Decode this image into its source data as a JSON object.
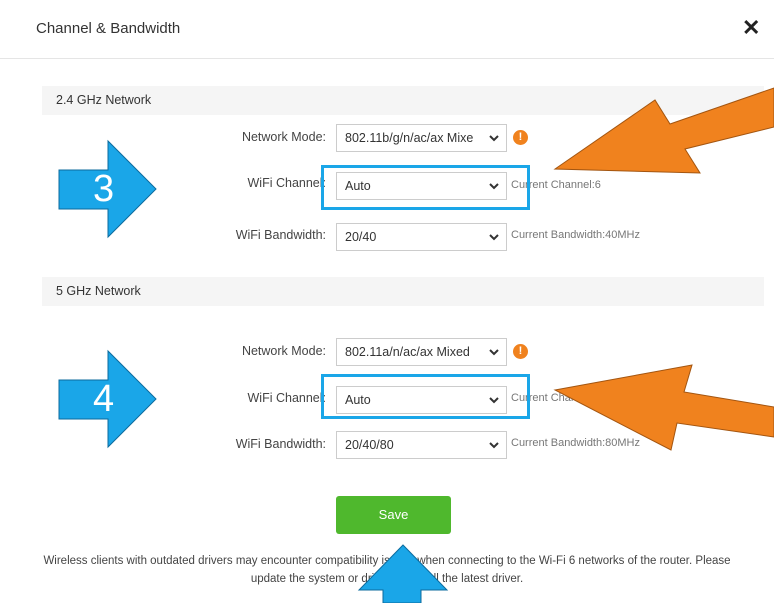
{
  "dialog": {
    "title": "Channel & Bandwidth",
    "close_symbol": "✕"
  },
  "sections": [
    {
      "heading": "2.4 GHz Network",
      "network_mode": {
        "label": "Network Mode:",
        "value": "802.11b/g/n/ac/ax Mixe"
      },
      "wifi_channel": {
        "label": "WiFi Channel:",
        "value": "Auto",
        "status": "Current Channel:6"
      },
      "wifi_bandwidth": {
        "label": "WiFi Bandwidth:",
        "value": "20/40",
        "status": "Current Bandwidth:40MHz"
      }
    },
    {
      "heading": "5 GHz Network",
      "network_mode": {
        "label": "Network Mode:",
        "value": "802.11a/n/ac/ax Mixed"
      },
      "wifi_channel": {
        "label": "WiFi Channel:",
        "value": "Auto",
        "status": "Current Channel:149"
      },
      "wifi_bandwidth": {
        "label": "WiFi Bandwidth:",
        "value": "20/40/80",
        "status": "Current Bandwidth:80MHz"
      }
    }
  ],
  "save_label": "Save",
  "note_line1": "Wireless clients with outdated drivers may encounter compatibility issues when connecting to the Wi-Fi 6 networks of the router. Please",
  "note_line2": "update the system or driver, or install the latest driver.",
  "annotations": {
    "step3": "3",
    "step4": "4",
    "highlight_color": "#1aa6e8",
    "arrow_blue": "#1aa6e8",
    "arrow_orange": "#f0821e"
  },
  "icons": {
    "close": "close-icon",
    "warning": "warning-icon",
    "dropdown": "chevron-down-icon"
  }
}
